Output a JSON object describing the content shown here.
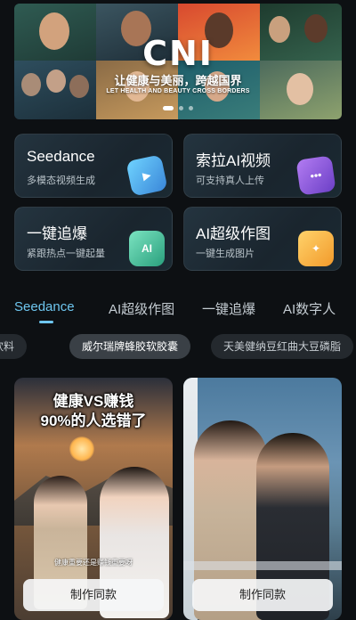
{
  "banner": {
    "logo": "CNI",
    "slogan": "让健康与美丽，跨越国界",
    "subtitle": "LET HEALTH AND BEAUTY CROSS BORDERS",
    "dots": 3,
    "active_dot": 0
  },
  "features": [
    {
      "title": "Seedance",
      "subtitle": "多模态视频生成",
      "icon": "seedance-icon"
    },
    {
      "title": "索拉AI视频",
      "subtitle": "可支持真人上传",
      "icon": "sora-icon"
    },
    {
      "title": "一键追爆",
      "subtitle": "紧跟热点一键起量",
      "icon": "ai-hot-icon",
      "icon_text": "AI"
    },
    {
      "title": "AI超级作图",
      "subtitle": "一键生成图片",
      "icon": "ai-draw-icon"
    }
  ],
  "tabs": {
    "items": [
      "Seedance",
      "AI超级作图",
      "一键追爆",
      "AI数字人"
    ],
    "active_index": 0,
    "active_color": "#6ec6ef"
  },
  "chips": {
    "items": [
      "农夫饮料",
      "威尔瑞牌蜂胶软胶囊",
      "天美健纳豆红曲大豆磷脂"
    ],
    "visible_first": "饮料",
    "active_index": 1
  },
  "templates": [
    {
      "title_line1": "健康VS赚钱",
      "title_line2": "90%的人选错了",
      "caption": "健康重要还是赚钱重要呀",
      "button": "制作同款"
    },
    {
      "button": "制作同款"
    }
  ]
}
